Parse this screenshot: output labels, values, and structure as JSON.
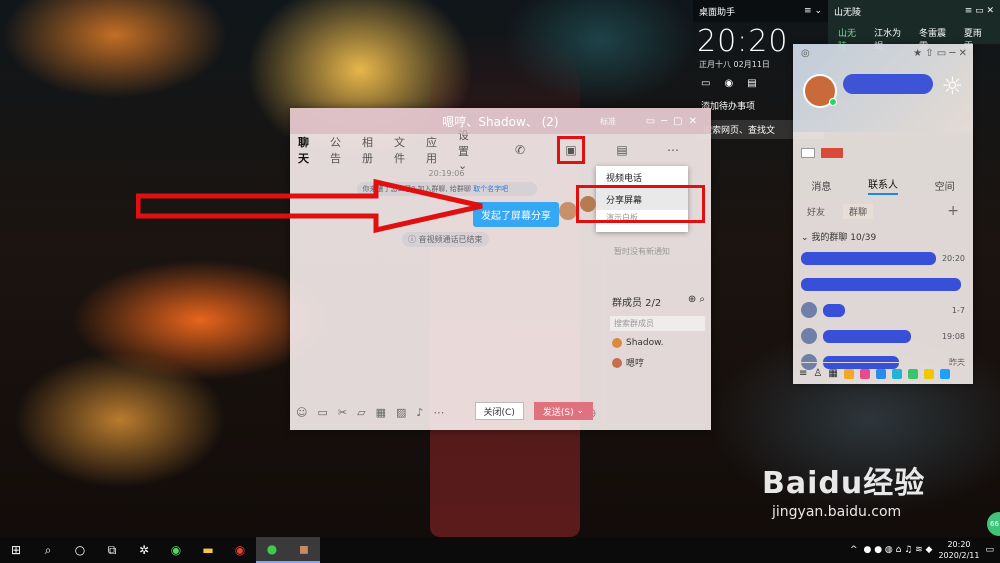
{
  "assistant": {
    "title": "桌面助手",
    "clock": "20:20",
    "date": "正月十八",
    "date2": "02月11日",
    "todo": "添加待办事项",
    "search": "搜索网页、查找文"
  },
  "topbar": {
    "title": "山无陵",
    "tabs": [
      "山无陵",
      "江水为竭",
      "冬雷震震",
      "夏雨雪"
    ]
  },
  "qq_main": {
    "tabs": [
      "消息",
      "联系人",
      "空间"
    ],
    "subtabs": [
      "好友",
      "群聊"
    ],
    "group_title": "我的群聊 10/39",
    "rows": [
      {
        "time": "20:20"
      },
      {
        "time": ""
      },
      {
        "time": "1-7"
      },
      {
        "time": "19:08"
      },
      {
        "time": "昨天"
      }
    ]
  },
  "chat": {
    "title": "嗯哼、Shadow、 (2)",
    "mode": "标准",
    "nav": [
      "聊天",
      "公告",
      "相册",
      "文件",
      "应用",
      "设置"
    ],
    "timestamp": "20:19:06",
    "system_msg_1": "你来遭了怎么了? 加入群聊, 给群聊",
    "system_msg_link": "取个名字吧",
    "bubble": "发起了屏幕分享",
    "system_msg_2": "音视频通话已结束",
    "notice": "暂时没有新通知",
    "members_title": "群成员 2/2",
    "member_search": "搜索群成员",
    "members": [
      "Shadow.",
      "嗯哼"
    ],
    "close_label": "关闭(C)",
    "send_label": "发送(S)"
  },
  "menu": {
    "items": [
      "视频电话",
      "分享屏幕",
      "演示白板"
    ]
  },
  "watermark": {
    "brand": "Baidu经验",
    "url": "jingyan.baidu.com"
  },
  "taskbar": {
    "time": "20:20",
    "date": "2020/2/11",
    "badge": "66"
  },
  "colors": {
    "highlight": "#e01010",
    "bubble": "#35a7f5",
    "send": "#e0727f"
  }
}
